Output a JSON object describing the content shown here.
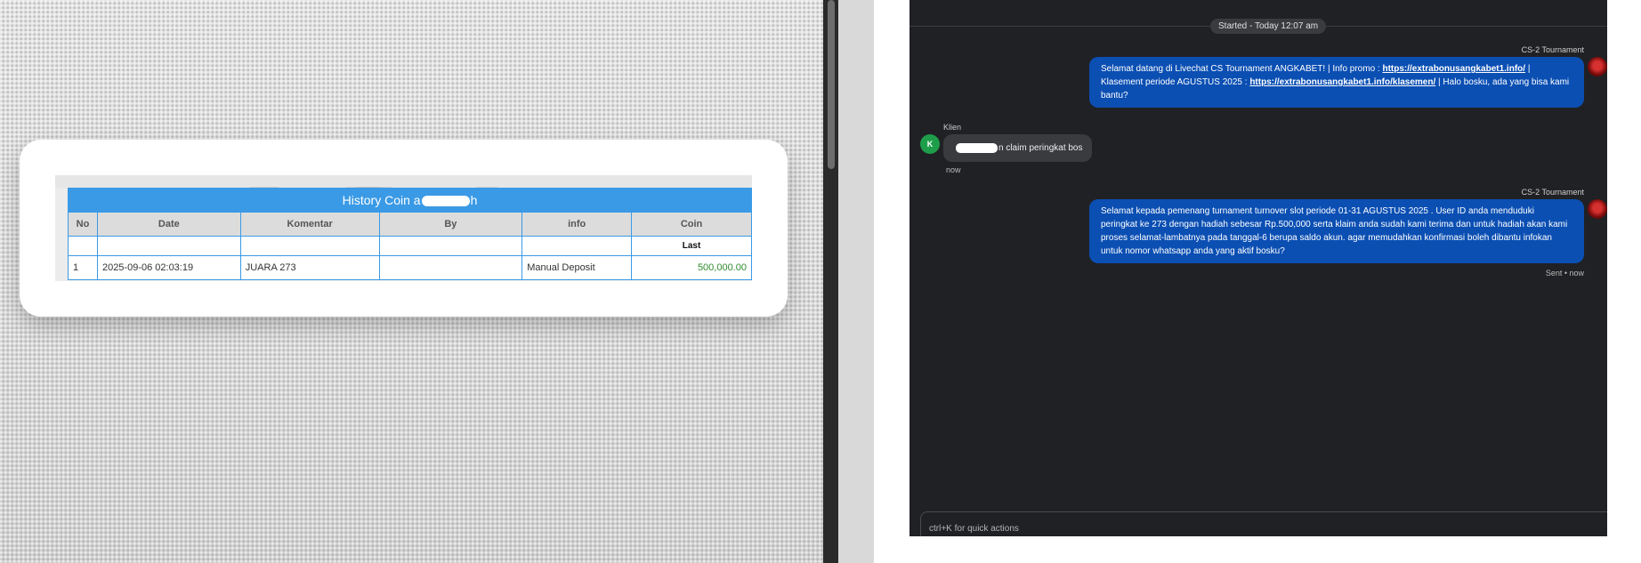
{
  "history": {
    "title_prefix": "History Coin a",
    "title_suffix": "h",
    "columns": [
      "No",
      "Date",
      "Komentar",
      "By",
      "info",
      "Coin"
    ],
    "sub_label": "Last",
    "rows": [
      {
        "no": "1",
        "date": "2025-09-06 02:03:19",
        "komentar": "JUARA 273",
        "by": "",
        "info": "Manual Deposit",
        "coin": "500,000.00"
      }
    ]
  },
  "chat": {
    "started": "Started - Today 12:07 am",
    "messages": [
      {
        "sender": "CS-2 Tournament",
        "avatar": "angkabet-logo",
        "part1": "Selamat datang di Livechat CS Tournament ANGKABET! | Info promo : ",
        "link1": "https://extrabonusangkabet1.info/",
        "part2": " | Klasement periode AGUSTUS 2025 : ",
        "link2": "https://extrabonusangkabet1.info/klasemen/",
        "part3": " | Halo bosku, ada yang bisa kami bantu?"
      },
      {
        "sender": "Klien",
        "avatar_letter": "K",
        "text_suffix": "n claim peringkat bos",
        "time": "now"
      },
      {
        "sender": "CS-2 Tournament",
        "avatar": "angkabet-logo",
        "text": "Selamat kepada pemenang turnament turnover slot periode 01-31 AGUSTUS 2025 . User ID anda menduduki peringkat ke 273 dengan hadiah sebesar Rp.500,000 serta klaim anda sudah kami terima dan untuk hadiah akan kami proses selamat-lambatnya pada tanggal-6 berupa saldo akun. agar memudahkan konfirmasi boleh dibantu infokan untuk nomor whatsapp anda yang aktif bosku?",
        "status": "Sent • now"
      }
    ],
    "composer_placeholder": "ctrl+K for quick actions"
  },
  "colors": {
    "table_header": "#3a9ae6",
    "agent_bubble": "#0b4fb3",
    "client_avatar": "#1e9e4a",
    "chat_bg": "#202124",
    "amount_green": "#2e8b2e"
  }
}
